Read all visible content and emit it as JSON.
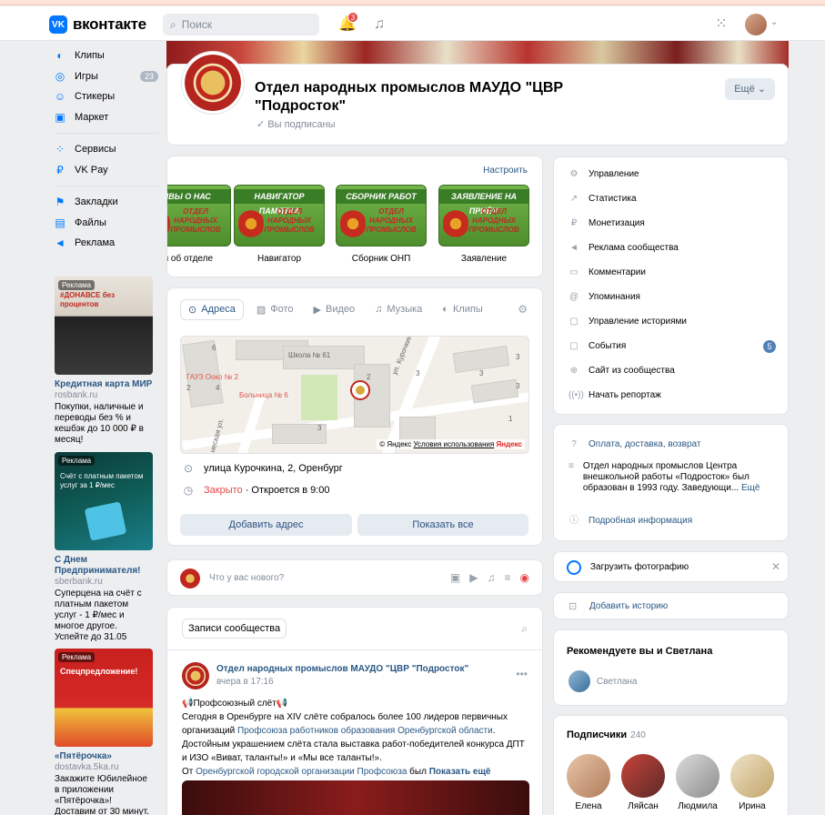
{
  "header": {
    "logo_text": "вконтакте",
    "search_placeholder": "Поиск",
    "notifications_count": "3"
  },
  "sidebar": {
    "items": [
      {
        "label": "Клипы",
        "icon": "clips-icon"
      },
      {
        "label": "Игры",
        "icon": "games-icon",
        "count": "23"
      },
      {
        "label": "Стикеры",
        "icon": "stickers-icon"
      },
      {
        "label": "Маркет",
        "icon": "market-icon"
      },
      {
        "label": "Сервисы",
        "icon": "services-icon"
      },
      {
        "label": "VK Pay",
        "icon": "vkpay-icon"
      },
      {
        "label": "Закладки",
        "icon": "bookmarks-icon"
      },
      {
        "label": "Файлы",
        "icon": "files-icon"
      },
      {
        "label": "Реклама",
        "icon": "ads-icon"
      }
    ]
  },
  "ads": [
    {
      "tag": "Реклама",
      "banner_text": "#ДОНАВСЕ без процентов",
      "title": "Кредитная карта МИР",
      "domain": "rosbank.ru",
      "text": "Покупки, наличные и переводы без % и кешбэк до 10 000 ₽ в месяц!"
    },
    {
      "tag": "Реклама",
      "banner_text": "Счёт с платным пакетом услуг за 1 ₽/мес",
      "title": "С Днем Предпринимателя!",
      "domain": "sberbank.ru",
      "text": "Суперцена на счёт с платным пакетом услуг - 1 ₽/мес и многое другое. Успейте до 31.05"
    },
    {
      "tag": "Реклама",
      "banner_text": "Спецпредложение!",
      "title": "«Пятёрочка»",
      "domain": "dostavka.5ka.ru",
      "text": "Закажите Юбилейное в приложении «Пятёрочка»! Доставим от 30 минут."
    }
  ],
  "group": {
    "title": "Отдел народных промыслов МАУДО \"ЦВР \"Подросток\"",
    "subscribed": "Вы подписаны",
    "more_button": "Ещё"
  },
  "links": {
    "configure": "Настроить",
    "tiles": [
      {
        "banner": "ЫВЫ О НАС",
        "label": "ы об отделе"
      },
      {
        "banner": "НАВИГАТОР ПАМЯТКА",
        "label": "Навигатор"
      },
      {
        "banner": "СБОРНИК РАБОТ",
        "label": "Сборник ОНП"
      },
      {
        "banner": "ЗАЯВЛЕНИЕ НА ПРИЁМ",
        "label": "Заявление"
      }
    ],
    "tile_mark": "ОТДЕЛ НАРОДНЫХ ПРОМЫСЛОВ"
  },
  "address_card": {
    "tabs": [
      "Адреса",
      "Фото",
      "Видео",
      "Музыка",
      "Клипы"
    ],
    "map_labels": {
      "school": "Школа № 61",
      "hospital": "Больница № 6",
      "gauz": "ГАУЗ Ооко № 2",
      "street1": "ул. Курочкина",
      "street2": "неская ул.",
      "credit_yandex": "© Яндекс",
      "credit_terms": "Условия использования",
      "credit_brand": "Яндекс",
      "house_numbers": [
        "6",
        "2",
        "4",
        "2",
        "3",
        "3",
        "3",
        "3",
        "1",
        "3"
      ]
    },
    "address": "улица Курочкина, 2, Оренбург",
    "status_closed": "Закрыто",
    "status_opens": " · Откроется в 9:00",
    "add_address": "Добавить адрес",
    "show_all": "Показать все"
  },
  "compose": {
    "placeholder": "Что у вас нового?"
  },
  "feed": {
    "tab": "Записи сообщества",
    "post": {
      "author": "Отдел народных промыслов МАУДО \"ЦВР \"Подросток\"",
      "time": "вчера в 17:16",
      "line1": "Профсоюзный слёт",
      "line2a": "Сегодня в Оренбурге на XIV слёте собралось более 100 лидеров первичных организаций ",
      "link1": "Профсоюза работников образования Оренбургской области",
      "line2b": ".",
      "line3": "Достойным украшением слёта стала выставка работ-победителей конкурса ДПТ и ИЗО «Виват, таланты!» и «Мы все таланты!».",
      "line4a": "От ",
      "link2": "Оренбургской городской организации Профсоюза",
      "line4b": " был",
      "show_more": "Показать ещё"
    }
  },
  "manage": {
    "items": [
      {
        "label": "Управление",
        "icon": "gear-icon"
      },
      {
        "label": "Статистика",
        "icon": "stats-icon"
      },
      {
        "label": "Монетизация",
        "icon": "coin-icon"
      },
      {
        "label": "Реклама сообщества",
        "icon": "megaphone-icon"
      },
      {
        "label": "Комментарии",
        "icon": "comment-icon"
      },
      {
        "label": "Упоминания",
        "icon": "at-icon"
      },
      {
        "label": "Управление историями",
        "icon": "story-icon"
      },
      {
        "label": "События",
        "icon": "event-icon",
        "badge": "5"
      },
      {
        "label": "Сайт из сообщества",
        "icon": "globe-icon"
      },
      {
        "label": "Начать репортаж",
        "icon": "live-icon"
      }
    ]
  },
  "info": {
    "payment": "Оплата, доставка, возврат",
    "description": "Отдел народных промыслов Центра внешкольной работы «Подросток» был образован в 1993 году. Заведующи...",
    "desc_more": "Ещё",
    "details": "Подробная информация"
  },
  "upload_photo": "Загрузить фотографию",
  "add_story": "Добавить историю",
  "recommend": {
    "title": "Рекомендуете вы и Светлана",
    "name": "Светлана"
  },
  "subscribers": {
    "title": "Подписчики",
    "count": "240",
    "people": [
      "Елена",
      "Ляйсан",
      "Людмила",
      "Ирина"
    ]
  },
  "colors": {
    "accent": "#0077ff",
    "link": "#2a5885",
    "closed": "#e64646"
  }
}
